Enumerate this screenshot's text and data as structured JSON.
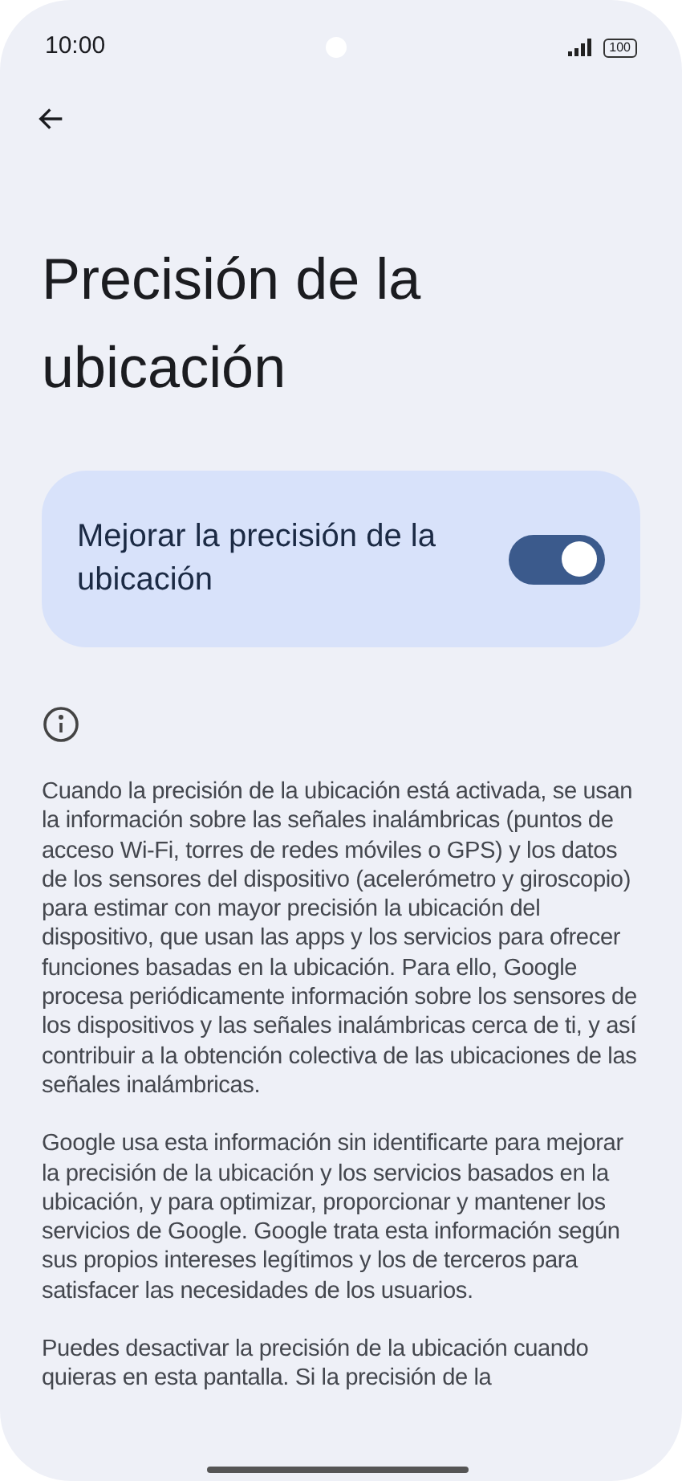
{
  "status_bar": {
    "time": "10:00",
    "battery": "100"
  },
  "title": "Precisión de la ubicación",
  "setting": {
    "label": "Mejorar la precisión de la ubicación",
    "on": true
  },
  "paragraphs": [
    "Cuando la precisión de la ubicación está activada, se usan la información sobre las señales inalámbricas (puntos de acceso Wi-Fi, torres de redes móviles o GPS) y los datos de los sensores del dispositivo (acelerómetro y giroscopio) para estimar con mayor precisión la ubicación del dispositivo, que usan las apps y los servicios para ofrecer funciones basadas en la ubicación. Para ello, Google procesa periódicamente información sobre los sensores de los dispositivos y las señales inalámbricas cerca de ti, y así contribuir a la obtención colectiva de las ubicaciones de las señales inalámbricas.",
    "Google usa esta información sin identificarte para mejorar la precisión de la ubicación y los servicios basados en la ubicación, y para optimizar, proporcionar y mantener los servicios de Google. Google trata esta información según sus propios intereses legítimos y los de terceros para satisfacer las necesidades de los usuarios.",
    "Puedes desactivar la precisión de la ubicación cuando quieras en esta pantalla. Si la precisión de la"
  ]
}
